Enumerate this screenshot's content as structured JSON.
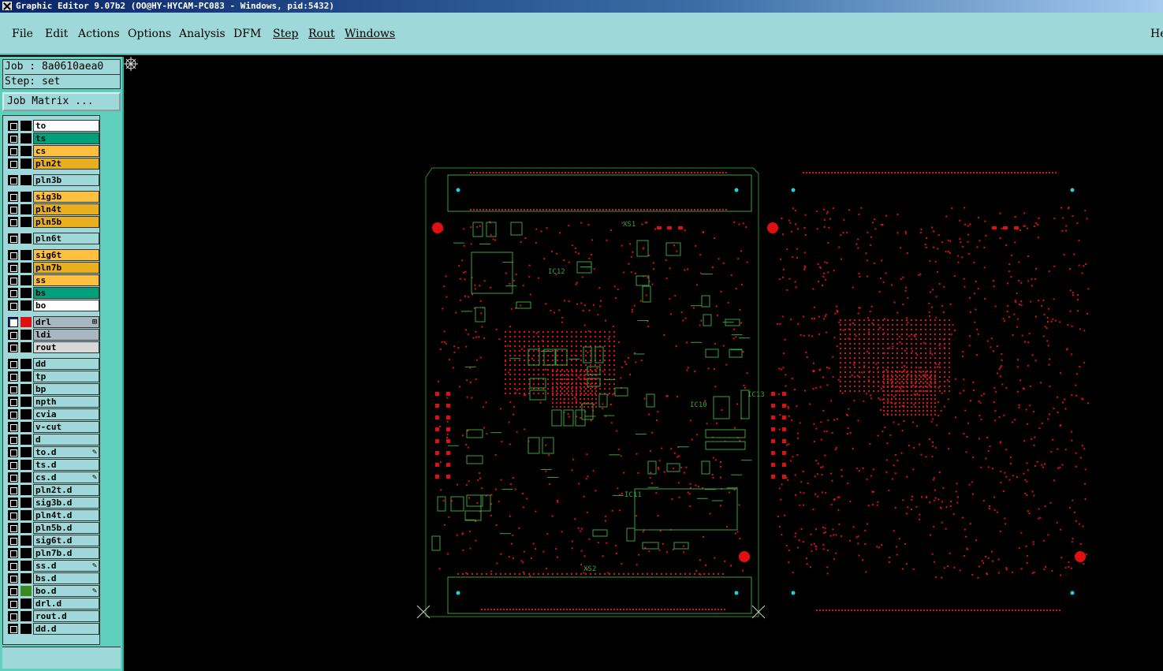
{
  "window": {
    "title": "Graphic Editor 9.07b2 (OO@HY-HYCAM-PC083 - Windows, pid:5432)"
  },
  "menu": [
    {
      "label": "File",
      "underline": false
    },
    {
      "label": "Edit",
      "underline": false
    },
    {
      "label": "Actions",
      "underline": false
    },
    {
      "label": "Options",
      "underline": false
    },
    {
      "label": "Analysis",
      "underline": false
    },
    {
      "label": "DFM",
      "underline": false
    },
    {
      "label": "Step",
      "underline": true
    },
    {
      "label": "Rout",
      "underline": true
    },
    {
      "label": "Windows",
      "underline": true
    }
  ],
  "menu_help": "He",
  "job": {
    "job_line": "Job : 8a0610aea0",
    "step_line": "Step: set",
    "matrix_button": "Job Matrix ..."
  },
  "layer_groups": [
    [
      {
        "name": "to",
        "color": "#ffffff"
      },
      {
        "name": "ts",
        "color": "#00a07a"
      },
      {
        "name": "cs",
        "color": "#ffc040"
      },
      {
        "name": "pln2t",
        "color": "#e8b020"
      }
    ],
    [
      {
        "name": "pln3b",
        "color": "#9ed8d8"
      }
    ],
    [
      {
        "name": "sig3b",
        "color": "#ffc040"
      },
      {
        "name": "pln4t",
        "color": "#e8b020"
      },
      {
        "name": "pln5b",
        "color": "#e8b020"
      }
    ],
    [
      {
        "name": "pln6t",
        "color": "#9ed8d8"
      }
    ],
    [
      {
        "name": "sig6t",
        "color": "#ffc040"
      },
      {
        "name": "pln7b",
        "color": "#e8b020"
      },
      {
        "name": "ss",
        "color": "#ffc040"
      },
      {
        "name": "bs",
        "color": "#00a07a"
      },
      {
        "name": "bo",
        "color": "#ffffff"
      }
    ],
    [
      {
        "name": "drl",
        "color": "#a8b8c0",
        "active": true,
        "mark": "⊞"
      },
      {
        "name": "ldi",
        "color": "#a8b8c0"
      },
      {
        "name": "rout",
        "color": "#d8d8d8"
      }
    ],
    [
      {
        "name": "dd",
        "color": "#9ed8d8"
      },
      {
        "name": "tp",
        "color": "#9ed8d8"
      },
      {
        "name": "bp",
        "color": "#9ed8d8"
      },
      {
        "name": "npth",
        "color": "#9ed8d8"
      },
      {
        "name": "cvia",
        "color": "#9ed8d8"
      },
      {
        "name": "v-cut",
        "color": "#9ed8d8"
      },
      {
        "name": "d",
        "color": "#9ed8d8"
      },
      {
        "name": "to.d",
        "color": "#9ed8d8",
        "mark": "✎"
      },
      {
        "name": "ts.d",
        "color": "#9ed8d8"
      },
      {
        "name": "cs.d",
        "color": "#9ed8d8",
        "mark": "✎"
      },
      {
        "name": "pln2t.d",
        "color": "#9ed8d8"
      },
      {
        "name": "sig3b.d",
        "color": "#9ed8d8"
      },
      {
        "name": "pln4t.d",
        "color": "#9ed8d8"
      },
      {
        "name": "pln5b.d",
        "color": "#9ed8d8"
      },
      {
        "name": "sig6t.d",
        "color": "#9ed8d8"
      },
      {
        "name": "pln7b.d",
        "color": "#9ed8d8"
      },
      {
        "name": "ss.d",
        "color": "#9ed8d8",
        "mark": "✎"
      },
      {
        "name": "bs.d",
        "color": "#9ed8d8"
      },
      {
        "name": "bo.d",
        "color": "#9ed8d8",
        "mark": "✎",
        "swatch": "#3a8a20"
      },
      {
        "name": "drl.d",
        "color": "#9ed8d8"
      },
      {
        "name": "rout.d",
        "color": "#9ed8d8"
      },
      {
        "name": "dd.d",
        "color": "#9ed8d8"
      }
    ]
  ],
  "board_labels": [
    "IC12",
    "XS1",
    "XS2",
    "IC11",
    "IC10",
    "IC13"
  ],
  "colors": {
    "outline": "#2a8a2a",
    "silk": "#3aa03a",
    "drill": "#e01010",
    "fiducial": "#20d0e0"
  },
  "icons": {
    "crosshair": "crosshair-icon"
  }
}
